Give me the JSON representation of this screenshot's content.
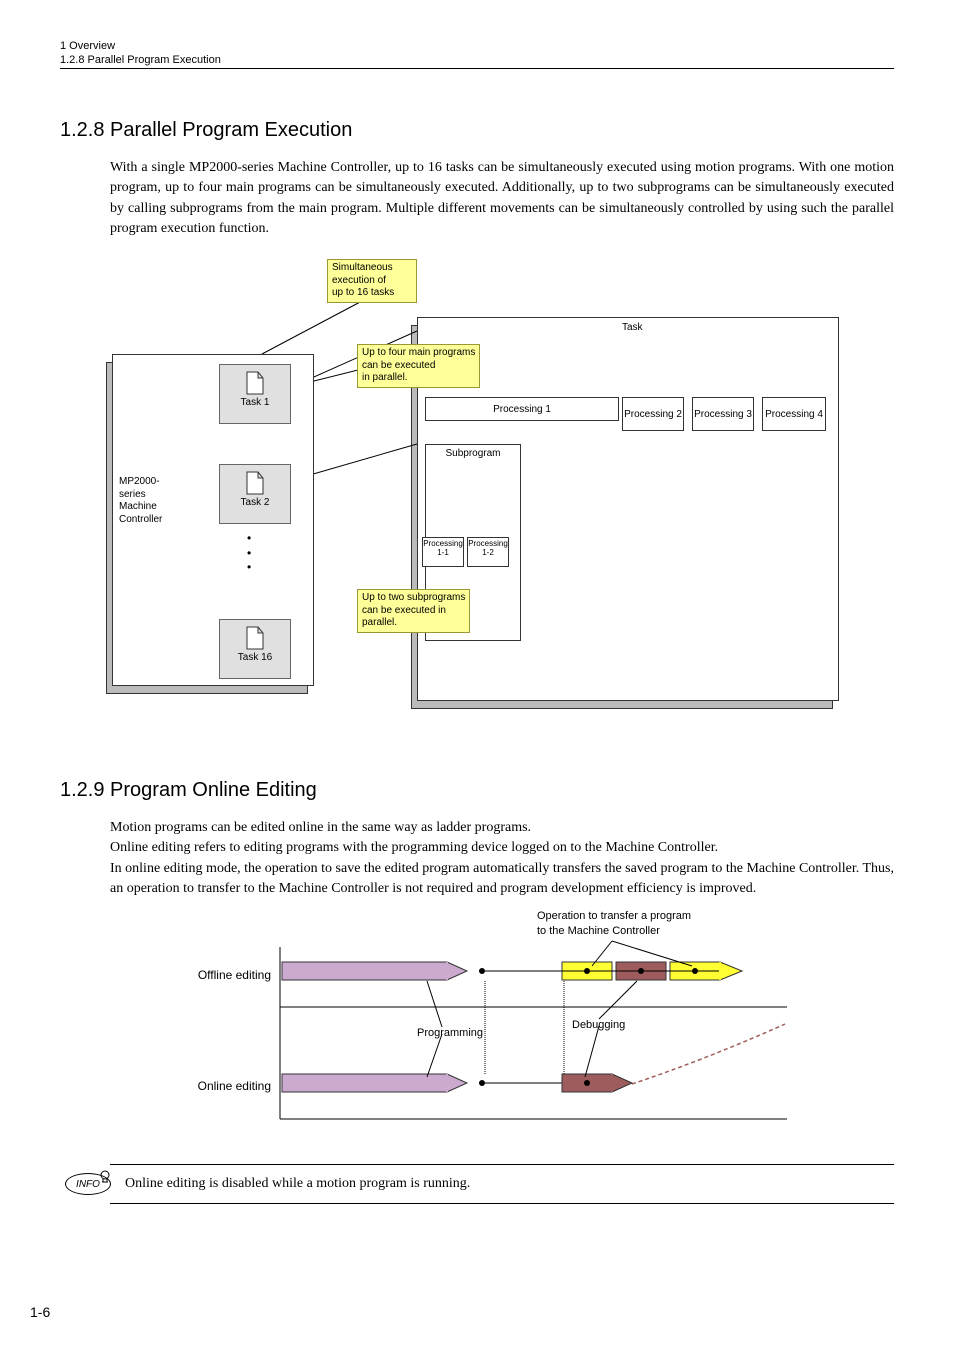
{
  "header": {
    "chapter": "1  Overview",
    "section": "1.2.8  Parallel Program Execution"
  },
  "sec128": {
    "title": "1.2.8  Parallel Program Execution",
    "body": "With a single MP2000-series Machine Controller, up to 16 tasks can be simultaneously executed using motion programs. With one motion program, up to four main programs can be simultaneously executed. Additionally, up to two subprograms can be simultaneously executed by calling subprograms from the main program. Multiple different movements can be simultaneously controlled by using such the parallel program execution function."
  },
  "diagram1": {
    "yellow1": "Simultaneous\nexecution of\nup to 16 tasks",
    "yellow2": "Up to four main programs\ncan be executed\nin parallel.",
    "yellow3": "Up to two subprograms\ncan be executed in\nparallel.",
    "controller": "MP2000-\nseries\nMachine\nController",
    "tasks": [
      "Task 1",
      "Task 2",
      "Task 16"
    ],
    "task_label": "Task",
    "processing": [
      "Processing 1",
      "Processing 2",
      "Processing 3",
      "Processing 4"
    ],
    "subprogram": "Subprogram",
    "small_proc": [
      "Processing\n1-1",
      "Processing\n1-2"
    ]
  },
  "sec129": {
    "title": "1.2.9  Program Online Editing",
    "body": "Motion programs can be edited online in the same way as ladder programs.\nOnline editing refers to editing programs with the programming device logged on to the Machine Controller.\nIn online editing mode, the operation to save the edited program automatically transfers the saved program to the Machine Controller. Thus, an operation to transfer to the Machine Controller is not required and program development efficiency is improved."
  },
  "diagram2": {
    "top_label": "Operation to transfer a program\nto the Machine Controller",
    "row1": "Offline editing",
    "row2": "Online editing",
    "programming": "Programming",
    "debugging": "Debugging"
  },
  "info": {
    "badge": "INFO",
    "text": "Online editing is disabled while a motion program is running."
  },
  "page_num": "1-6"
}
